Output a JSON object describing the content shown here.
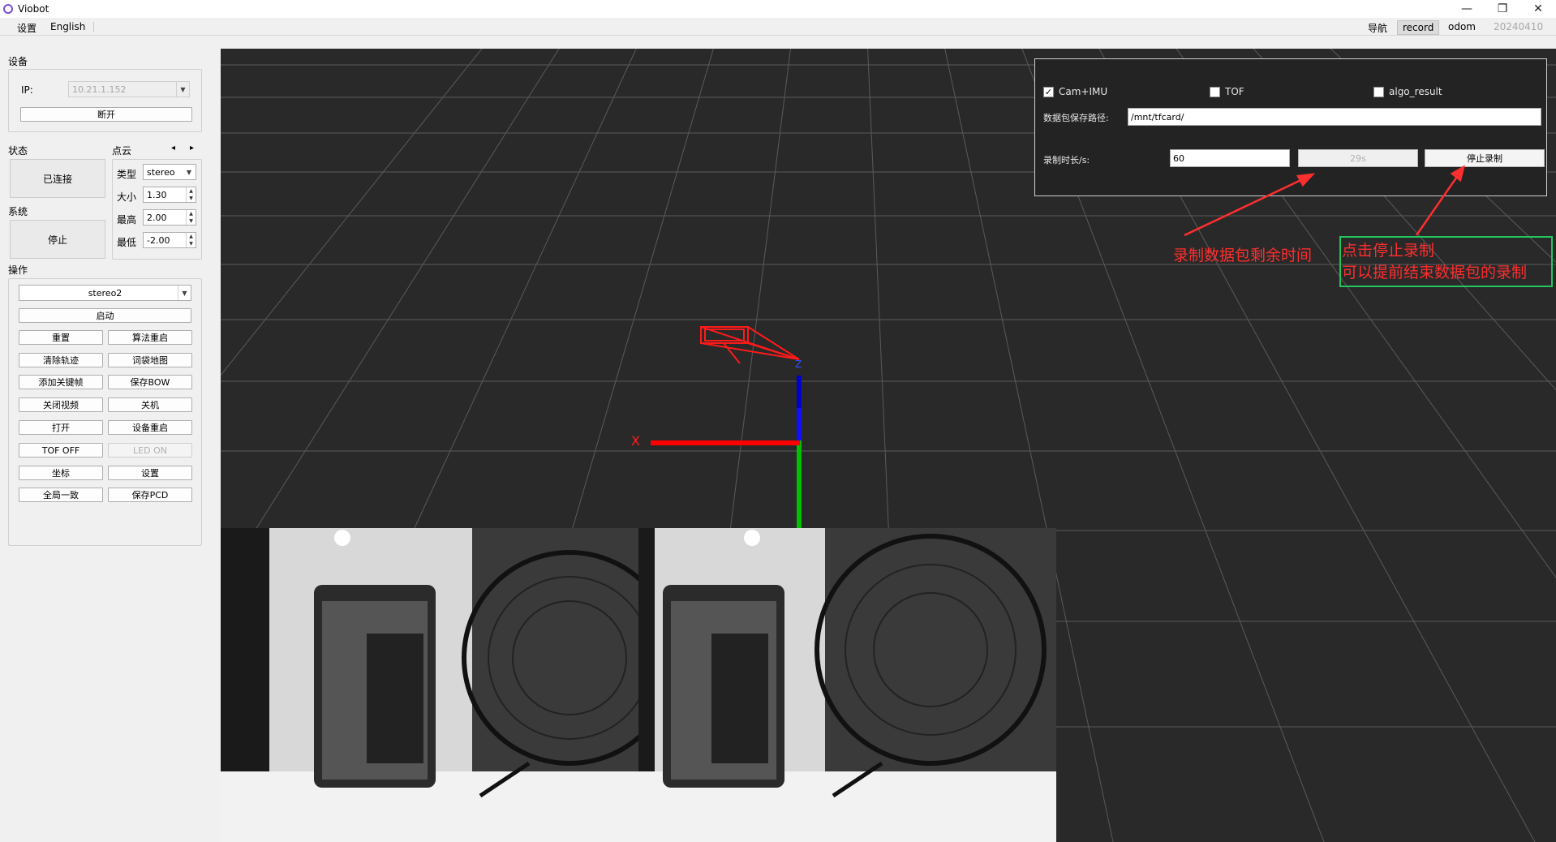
{
  "window": {
    "title": "Viobot",
    "minimize": "—",
    "restore": "❐",
    "close": "✕"
  },
  "menu": {
    "settings": "设置",
    "language": "English"
  },
  "top_tabs": {
    "nav": "导航",
    "record": "record",
    "odom": "odom",
    "version": "20240410"
  },
  "device": {
    "section": "设备",
    "ip_label": "IP:",
    "ip_value": "10.21.1.152",
    "disconnect": "断开"
  },
  "status": {
    "section": "状态",
    "value": "已连接"
  },
  "system": {
    "section": "系统",
    "value": "停止"
  },
  "pointcloud": {
    "section": "点云",
    "prev": "◂",
    "next": "▸",
    "type_label": "类型",
    "type_value": "stereo",
    "size_label": "大小",
    "size_value": "1.30",
    "max_label": "最高",
    "max_value": "2.00",
    "min_label": "最低",
    "min_value": "-2.00"
  },
  "operation": {
    "section": "操作",
    "mode": "stereo2",
    "start": "启动",
    "buttons": [
      [
        "重置",
        "算法重启"
      ],
      [
        "清除轨迹",
        "词袋地图"
      ],
      [
        "添加关键帧",
        "保存BOW"
      ],
      [
        "关闭视频",
        "关机"
      ],
      [
        "打开",
        "设备重启"
      ],
      [
        "TOF OFF",
        "LED ON"
      ],
      [
        "坐标",
        "设置"
      ],
      [
        "全局一致",
        "保存PCD"
      ]
    ]
  },
  "record_panel": {
    "cam_imu": "Cam+IMU",
    "tof": "TOF",
    "algo_result": "algo_result",
    "path_label": "数据包保存路径:",
    "path_value": "/mnt/tfcard/",
    "duration_label": "录制时长/s:",
    "duration_value": "60",
    "remaining": "29s",
    "stop": "停止录制"
  },
  "annotations": {
    "remaining_note": "录制数据包剩余时间",
    "stop_note_line1": "点击停止录制",
    "stop_note_line2": "可以提前结束数据包的录制"
  },
  "axes": {
    "x": "X",
    "y": "Y",
    "z": "Z"
  },
  "colors": {
    "x_axis": "#ff0000",
    "y_axis": "#00c000",
    "z_axis": "#0000ff",
    "annotation": "#ff2e2e",
    "annotation_box": "#22c55e"
  }
}
